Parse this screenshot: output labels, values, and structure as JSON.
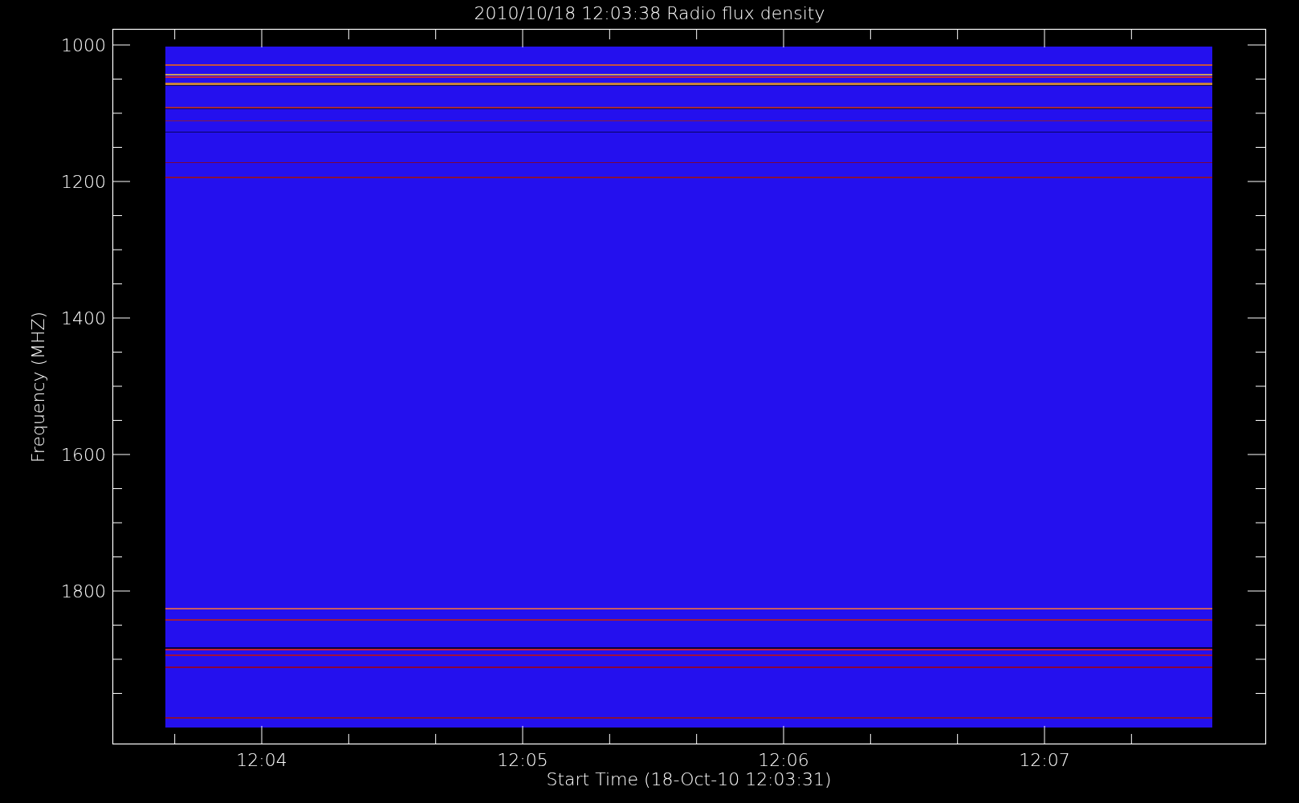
{
  "title": "2010/10/18 12:03:38 Radio flux density",
  "y_axis": {
    "label": "Frequency (MHZ)",
    "ticks": [
      "1000",
      "1200",
      "1400",
      "1600",
      "1800"
    ]
  },
  "x_axis": {
    "label": "Start Time (18-Oct-10 12:03:31)",
    "ticks": [
      "12:04",
      "12:05",
      "12:06",
      "12:07"
    ]
  }
}
